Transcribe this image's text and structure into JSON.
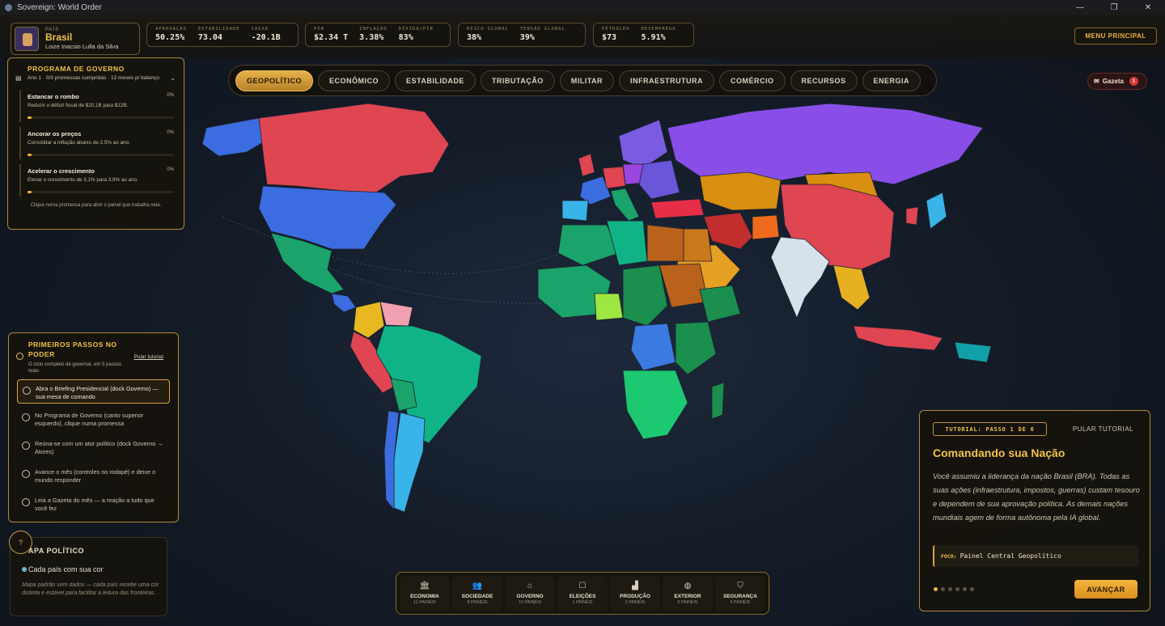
{
  "window": {
    "title": "Sovereign: World Order",
    "controls": [
      "—",
      "❐",
      "✕"
    ]
  },
  "country": {
    "label": "PAÍS",
    "name": "Brasil",
    "leader": "Loize Inacsio Lulla da Silva"
  },
  "stats": {
    "g1": [
      {
        "label": "APROVAÇÃO",
        "value": "50.25%"
      },
      {
        "label": "ESTABILIDADE",
        "value": "73.04"
      },
      {
        "label": "CAIXA",
        "value": "-20.1B"
      }
    ],
    "g2": [
      {
        "label": "PIB",
        "value": "$2.34 T"
      },
      {
        "label": "INFLAÇÃO",
        "value": "3.38%"
      },
      {
        "label": "DÍVIDA/PIB",
        "value": "83%"
      }
    ],
    "g3": [
      {
        "label": "RISCO GLOBAL",
        "value": "38%"
      },
      {
        "label": "TENSÃO GLOBAL",
        "value": "39%"
      }
    ],
    "g4": [
      {
        "label": "PETRÓLEO",
        "value": "$73"
      },
      {
        "label": "DESEMPREGO",
        "value": "5.91%"
      }
    ]
  },
  "menu_label": "MENU PRINCIPAL",
  "tabs": [
    "GEOPOLÍTICO",
    "ECONÔMICO",
    "ESTABILIDADE",
    "TRIBUTAÇÃO",
    "MILITAR",
    "INFRAESTRUTURA",
    "COMÉRCIO",
    "RECURSOS",
    "ENERGIA"
  ],
  "gazeta": {
    "label": "Gazeta",
    "count": "1"
  },
  "gov_program": {
    "title": "PROGRAMA DE GOVERNO",
    "subtitle": "Ano 1 · 0/3 promessas cumpridas · 12 meses p/ balanço",
    "promises": [
      {
        "title": "Estancar o rombo",
        "desc": "Reduzir o déficit fiscal de $20,1B para $12B.",
        "pct": "0%",
        "progress": 0.03
      },
      {
        "title": "Ancorar os preços",
        "desc": "Consolidar a inflação abaixo de 2,5% ao ano.",
        "pct": "0%",
        "progress": 0.03
      },
      {
        "title": "Acelerar o crescimento",
        "desc": "Elevar o crescimento de 3,1% para 3,9% ao ano.",
        "pct": "0%",
        "progress": 0.03
      }
    ],
    "hint": "Clique numa promessa para abrir o painel que trabalha nela."
  },
  "first_steps": {
    "title": "PRIMEIROS PASSOS NO PODER",
    "subtitle": "O ciclo completo de governar, em 5 passos reais",
    "skip": "Pular tutorial",
    "steps": [
      "Abra o Briefing Presidencial (dock Governo) — sua mesa de comando",
      "No Programa de Governo (canto superior esquerdo), clique numa promessa",
      "Reúna-se com um ator político (dock Governo → Atores)",
      "Avance o mês (controles no rodapé) e deixe o mundo responder",
      "Leia a Gazeta do mês — a reação a tudo que você fez"
    ]
  },
  "map_legend": {
    "title": "APA POLÍTICO",
    "option": "Cada país com sua cor",
    "desc": "Mapa padrão sem dados — cada país recebe uma cor distinta e estável para facilitar a leitura das fronteiras."
  },
  "dock": [
    {
      "label": "ECONOMIA",
      "count": "11 PAINÉIS",
      "icon": "bank-icon"
    },
    {
      "label": "SOCIEDADE",
      "count": "8 PAINÉIS",
      "icon": "people-icon"
    },
    {
      "label": "GOVERNO",
      "count": "10 PAINÉIS",
      "icon": "capitol-icon"
    },
    {
      "label": "ELEIÇÕES",
      "count": "1 PAINÉIS",
      "icon": "ballot-icon"
    },
    {
      "label": "PRODUÇÃO",
      "count": "2 PAINÉIS",
      "icon": "factory-icon"
    },
    {
      "label": "EXTERIOR",
      "count": "5 PAINÉIS",
      "icon": "globe-icon"
    },
    {
      "label": "SEGURANÇA",
      "count": "5 PAINÉIS",
      "icon": "shield-icon"
    }
  ],
  "tutorial": {
    "step": "TUTORIAL: PASSO 1 DE 6",
    "skip": "PULAR TUTORIAL",
    "title": "Comandando sua Nação",
    "body": "Você assumiu a liderança da nação Brasil (BRA). Todas as suas ações (infraestrutura, impostos, guerras) custam tesouro e dependem de sua aprovação política. As demais nações mundiais agem de forma autônoma pela IA global.",
    "focus_key": "FOCO:",
    "focus_value": "Painel Central Geopolítico",
    "next": "AVANÇAR",
    "total_steps": 6,
    "current_step": 1
  },
  "colors": {
    "accent": "#f0b43c",
    "panel_border": "#b08a3a",
    "ocean": "#162032"
  }
}
